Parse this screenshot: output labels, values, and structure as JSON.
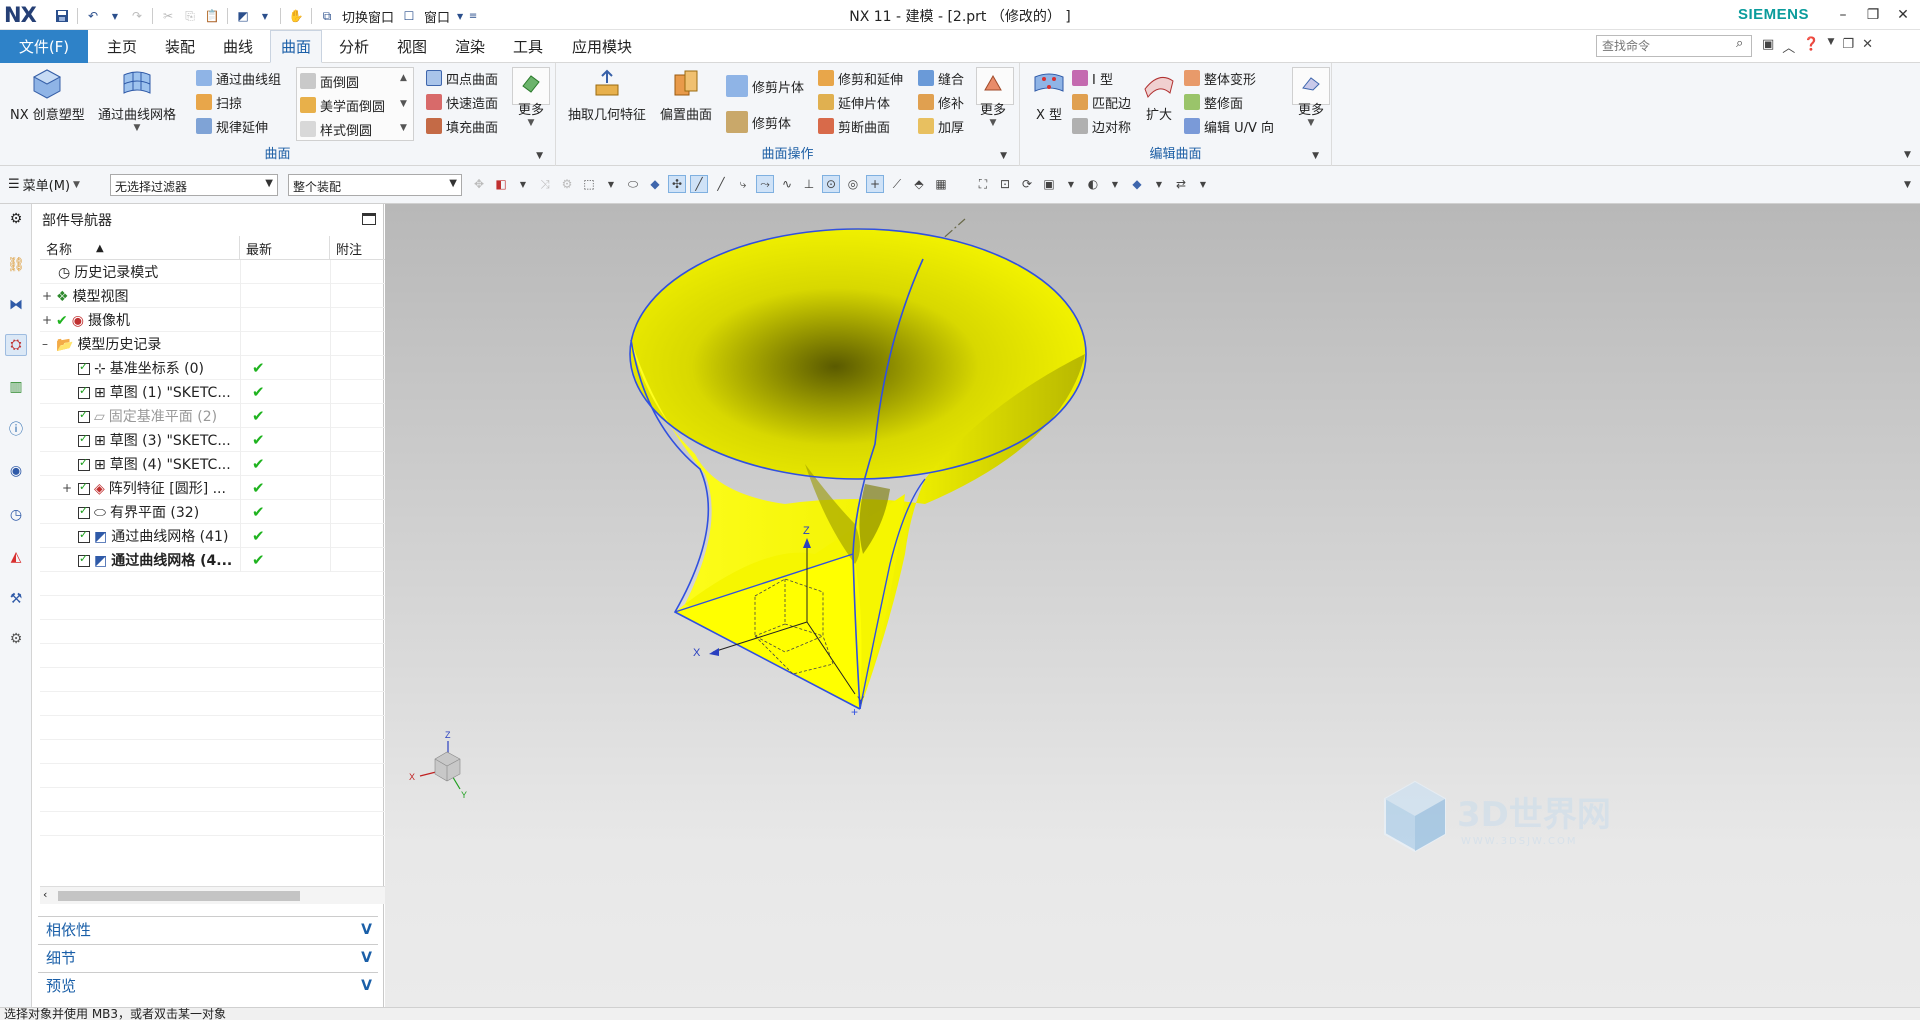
{
  "app": {
    "logo": "NX",
    "title": "NX 11 - 建模 - [2.prt （修改的） ]",
    "brand": "SIEMENS",
    "brand_color": "#0a9c9c",
    "accent": "#2e82c8"
  },
  "quick_access": {
    "switch_window": "切换窗口",
    "window": "窗口"
  },
  "tabs": {
    "file": "文件(F)",
    "items": [
      "主页",
      "装配",
      "曲线",
      "曲面",
      "分析",
      "视图",
      "渲染",
      "工具",
      "应用模块"
    ],
    "active": "曲面"
  },
  "search": {
    "placeholder": "查找命令"
  },
  "ribbon": {
    "surface_group": {
      "title": "曲面",
      "nx_creative": "NX 创意塑型",
      "through_curve_mesh": "通过曲线网格",
      "through_curves": "通过曲线组",
      "sweep": "扫掠",
      "law_extension": "规律延伸",
      "face_blend": "面倒圆",
      "aesthetic_blend": "美学面倒圆",
      "styled_blend": "样式倒圆",
      "four_point": "四点曲面",
      "quick_surface": "快速造面",
      "fill_surface": "填充曲面",
      "more": "更多"
    },
    "surface_ops_group": {
      "title": "曲面操作",
      "extract": "抽取几何特征",
      "offset": "偏置曲面",
      "trim_sheet": "修剪片体",
      "trim_body": "修剪体",
      "trim_extend": "修剪和延伸",
      "extend_sheet": "延伸片体",
      "divide_face": "剪断曲面",
      "sew": "缝合",
      "patch": "修补",
      "thicken": "加厚",
      "more": "更多"
    },
    "edit_surface_group": {
      "title": "编辑曲面",
      "x_form": "X 型",
      "i_form": "I 型",
      "match_edge": "匹配边",
      "edge_symmetry": "边对称",
      "enlarge": "扩大",
      "global_shaping": "整体变形",
      "refit": "整修面",
      "edit_uv": "编辑 U/V 向",
      "more": "更多"
    }
  },
  "toolbar2": {
    "menu": "菜单(M)",
    "filter": "无选择过滤器",
    "scope": "整个装配"
  },
  "navigator": {
    "title": "部件导航器",
    "columns": [
      "名称",
      "最新",
      "附注"
    ],
    "rows": [
      {
        "label": "历史记录模式",
        "icon": "clock-icon"
      },
      {
        "label": "模型视图",
        "icon": "views-icon"
      },
      {
        "label": "摄像机",
        "icon": "camera-icon"
      },
      {
        "label": "模型历史记录",
        "icon": "folder-icon"
      },
      {
        "label": "基准坐标系 (0)",
        "icon": "datum-csys-icon"
      },
      {
        "label": "草图 (1) \"SKETC...",
        "icon": "sketch-icon"
      },
      {
        "label": "固定基准平面 (2)",
        "icon": "datum-plane-icon"
      },
      {
        "label": "草图 (3) \"SKETC...",
        "icon": "sketch-icon"
      },
      {
        "label": "草图 (4) \"SKETC...",
        "icon": "sketch-icon"
      },
      {
        "label": "阵列特征 [圆形] ...",
        "icon": "pattern-icon"
      },
      {
        "label": "有界平面 (32)",
        "icon": "bounded-plane-icon"
      },
      {
        "label": "通过曲线网格 (41)",
        "icon": "mesh-icon"
      },
      {
        "label": "通过曲线网格 (4...",
        "icon": "mesh-icon"
      }
    ],
    "sections": [
      "相依性",
      "细节",
      "预览"
    ]
  },
  "graphics": {
    "surface_color": "#ffff00",
    "edge_color": "#3050e0",
    "axes": [
      "X",
      "Y",
      "Z"
    ],
    "triad": [
      "X",
      "Y",
      "Z"
    ],
    "watermark": "3D世界网",
    "watermark_url": "WWW.3DSJW.COM"
  },
  "status": {
    "message": "选择对象并使用 MB3，或者双击某一对象"
  }
}
